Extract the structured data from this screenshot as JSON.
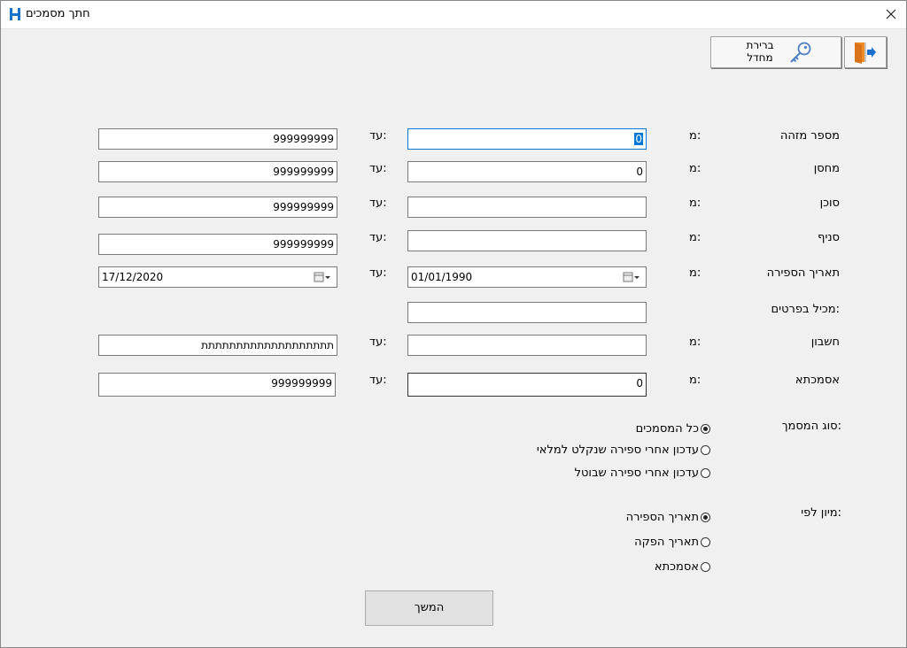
{
  "window": {
    "title": "חתך מסמכים",
    "app_icon": "H"
  },
  "toolbar": {
    "default_printer_line1": "ברירת",
    "default_printer_line2": "מחדל"
  },
  "labels": {
    "from": "מ:",
    "to": "עד:"
  },
  "rows": [
    {
      "label": "מספר מזהה",
      "from_value_selected": "0",
      "to_value": "999999999"
    },
    {
      "label": "מחסן",
      "from_value": "0",
      "to_value": "999999999"
    },
    {
      "label": "סוכן",
      "from_value": "",
      "to_value": "999999999"
    },
    {
      "label": "סניף",
      "from_value": "",
      "to_value": "999999999"
    },
    {
      "label": "תאריך הספירה",
      "from_value": "01/01/1990",
      "to_value": "17/12/2020"
    },
    {
      "label": "מכיל בפרטים:",
      "value": ""
    },
    {
      "label": "חשבון",
      "from_value": "",
      "to_value": "תתתתתתתתתתתתתתתתתתת"
    },
    {
      "label": "אסמכתא",
      "from_value": "0",
      "to_value": "999999999"
    }
  ],
  "doc_type": {
    "label": "סוג המסמך:",
    "options": [
      {
        "label": "כל המסמכים",
        "selected": true
      },
      {
        "label": "עדכון אחרי ספירה שנקלט למלאי",
        "selected": false
      },
      {
        "label": "עדכון אחרי ספירה שבוטל",
        "selected": false
      }
    ]
  },
  "sort_by": {
    "label": "מיון לפי:",
    "options": [
      {
        "label": "תאריך הספירה",
        "selected": true
      },
      {
        "label": "תאריך הפקה",
        "selected": false
      },
      {
        "label": "אסמכתא",
        "selected": false
      }
    ]
  },
  "buttons": {
    "continue": "המשך"
  },
  "icons": {
    "exit": "exit-door-icon",
    "key": "key-icon",
    "calendar": "calendar-icon",
    "close": "close-icon"
  },
  "colors": {
    "focus_border": "#0078d7",
    "selection": "#0078d7",
    "exit_orange": "#f08a24"
  }
}
